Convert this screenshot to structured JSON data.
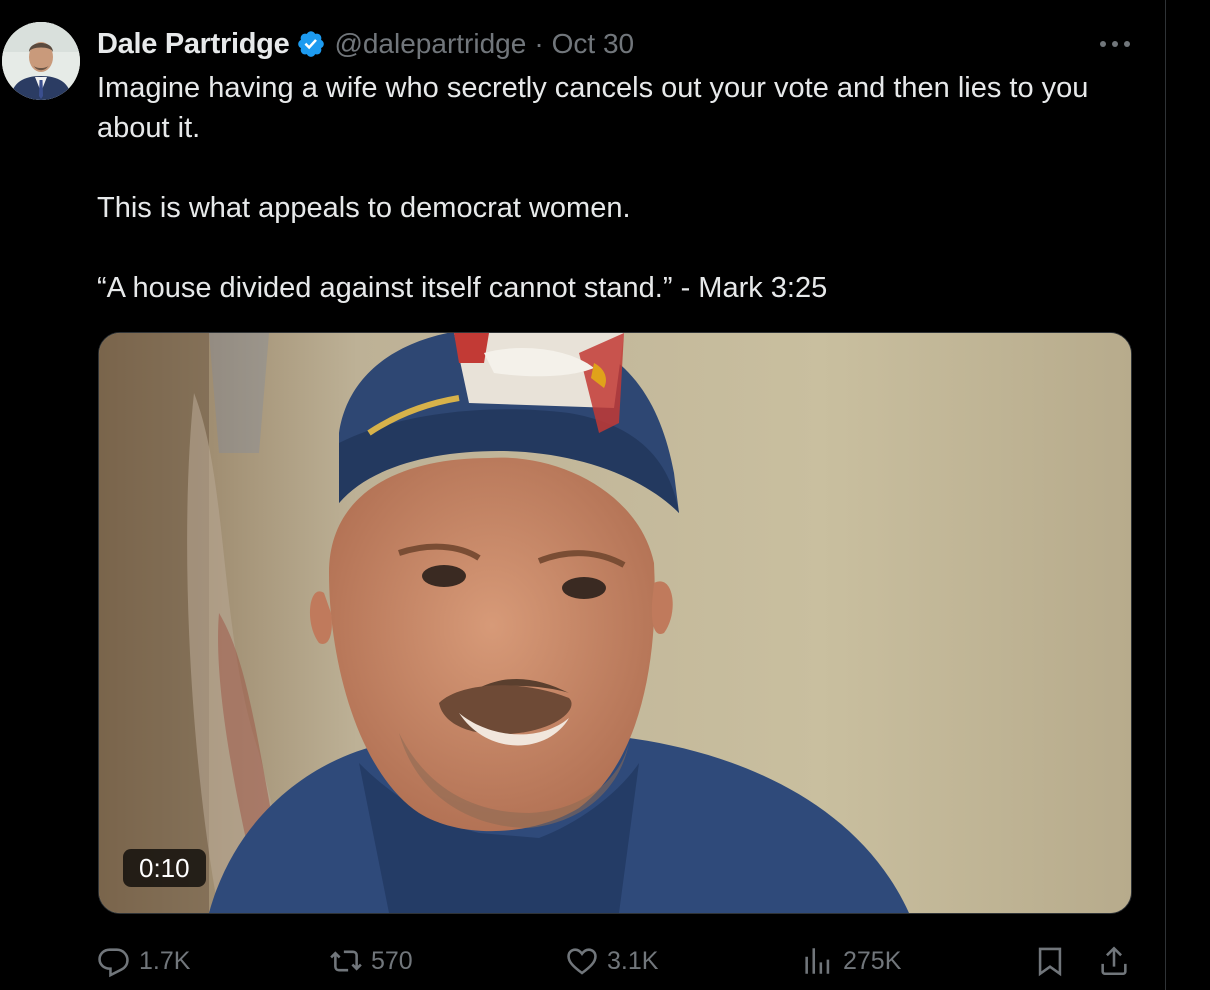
{
  "author": {
    "name": "Dale Partridge",
    "handle": "@dalepartridge",
    "separator": "·",
    "date": "Oct 30",
    "verified": true
  },
  "tweet": {
    "lines": [
      "Imagine having a wife who secretly cancels out your vote and then lies to you about it.",
      "This is what appeals to democrat women.",
      "“A house divided against itself cannot stand.” - Mark 3:25"
    ]
  },
  "media": {
    "type": "video",
    "duration": "0:10"
  },
  "actions": {
    "replies": "1.7K",
    "reposts": "570",
    "likes": "3.1K",
    "views": "275K"
  },
  "colors": {
    "background": "#000000",
    "text": "#e7e9ea",
    "muted": "#71767b",
    "verified": "#1d9bf0",
    "border": "#2f3336"
  },
  "icons": {
    "more": "more-horizontal-icon",
    "verified": "verified-badge-icon",
    "reply": "reply-icon",
    "repost": "repost-icon",
    "like": "heart-icon",
    "views": "views-icon",
    "bookmark": "bookmark-icon",
    "share": "share-icon"
  }
}
